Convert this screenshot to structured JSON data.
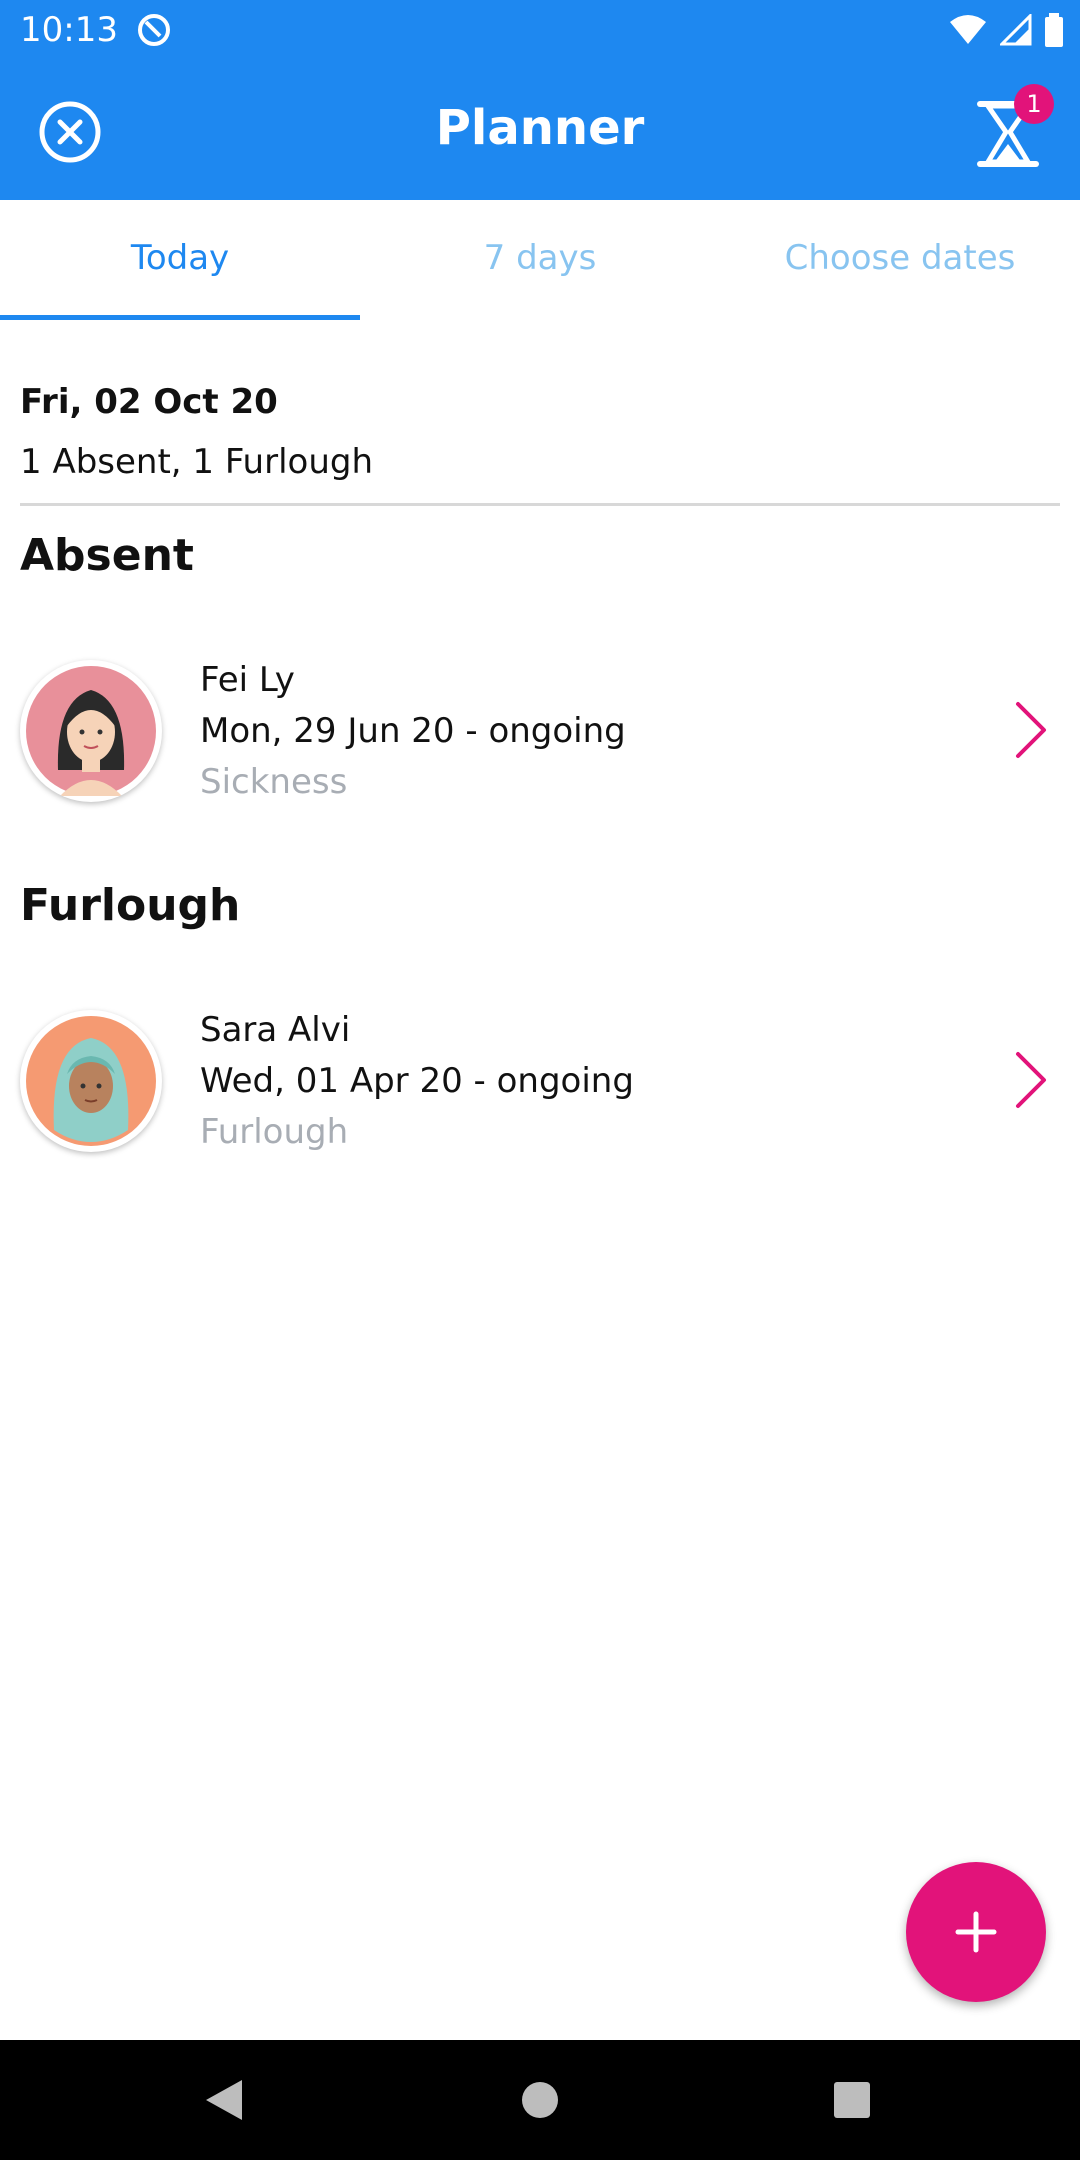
{
  "status_bar": {
    "time": "10:13"
  },
  "header": {
    "title": "Planner",
    "badge_count": "1"
  },
  "tabs": [
    {
      "label": "Today",
      "selected": true
    },
    {
      "label": "7 days",
      "selected": false
    },
    {
      "label": "Choose dates",
      "selected": false
    }
  ],
  "summary": {
    "date": "Fri, 02 Oct 20",
    "counts": "1 Absent, 1 Furlough"
  },
  "sections": [
    {
      "title": "Absent",
      "people": [
        {
          "name": "Fei Ly",
          "dates": "Mon, 29 Jun 20 - ongoing",
          "type": "Sickness"
        }
      ]
    },
    {
      "title": "Furlough",
      "people": [
        {
          "name": "Sara Alvi",
          "dates": "Wed, 01 Apr 20 - ongoing",
          "type": "Furlough"
        }
      ]
    }
  ],
  "colors": {
    "primary": "#1e88f0",
    "accent": "#e2137a",
    "muted_text": "#a8adb4"
  }
}
